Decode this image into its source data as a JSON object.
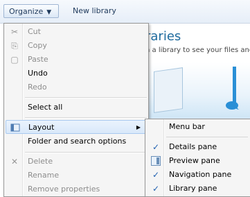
{
  "toolbar": {
    "organize_label": "Organize",
    "organize_arrow": "▼",
    "new_library_label": "New library"
  },
  "library": {
    "title": "raries",
    "subtitle": "n a library to see your files and"
  },
  "menu": {
    "cut": "Cut",
    "copy": "Copy",
    "paste": "Paste",
    "undo": "Undo",
    "redo": "Redo",
    "select_all": "Select all",
    "layout": "Layout",
    "layout_arrow": "▶",
    "folder_options": "Folder and search options",
    "delete": "Delete",
    "rename": "Rename",
    "remove_properties": "Remove properties"
  },
  "icons": {
    "cut": "✂",
    "copy": "⎘",
    "paste": "▢",
    "delete": "✕"
  },
  "layout_submenu": {
    "menu_bar": "Menu bar",
    "details_pane": "Details pane",
    "preview_pane": "Preview pane",
    "navigation_pane": "Navigation pane",
    "library_pane": "Library pane",
    "check": "✓"
  },
  "colors": {
    "highlight": "#d9e8fa",
    "check": "#1f5fb0",
    "title": "#1f6b9e"
  }
}
